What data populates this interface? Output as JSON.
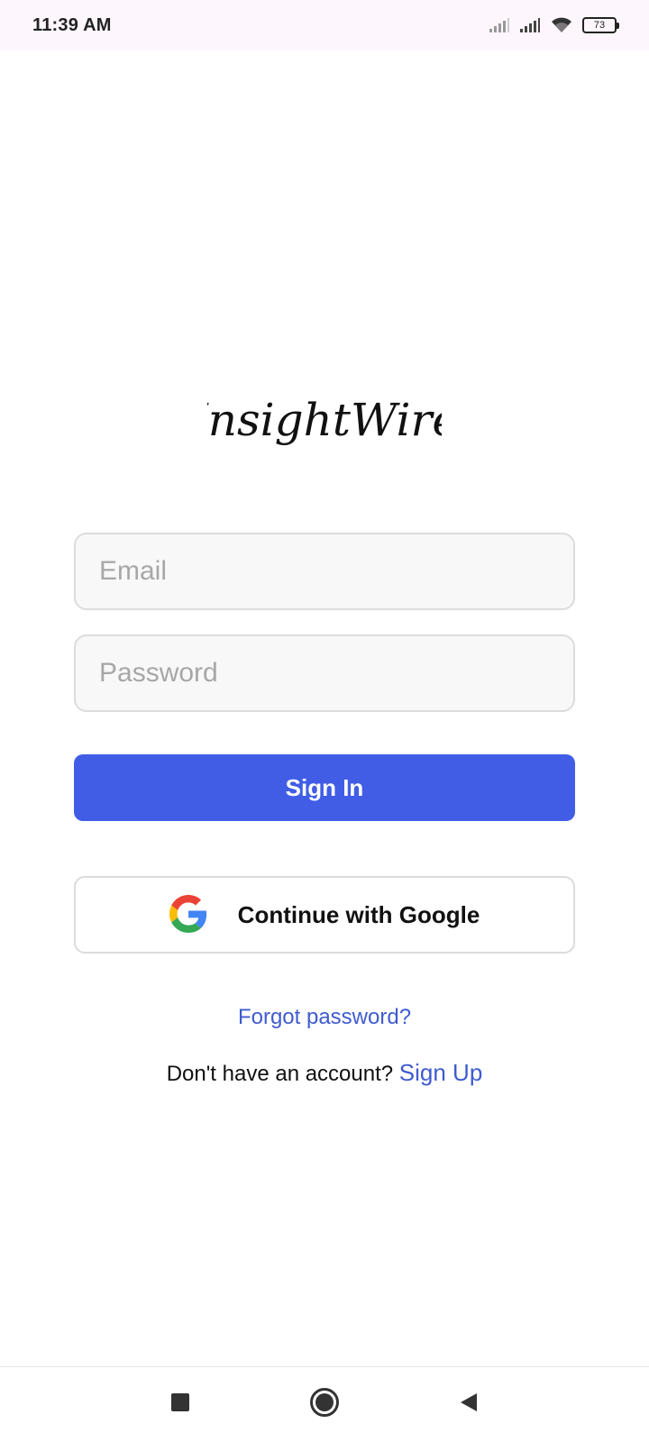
{
  "status_bar": {
    "time": "11:39 AM",
    "battery_level": "73",
    "icons": [
      "signal-icon",
      "signal-icon",
      "wifi-icon",
      "battery-icon"
    ]
  },
  "app": {
    "logo_text": "InsightWire"
  },
  "form": {
    "email_placeholder": "Email",
    "email_value": "",
    "password_placeholder": "Password",
    "password_value": "",
    "signin_label": "Sign In",
    "google_label": "Continue with Google",
    "forgot_label": "Forgot password?",
    "no_account_text": "Don't have an account?",
    "signup_label": "Sign Up"
  },
  "colors": {
    "primary": "#415de6",
    "link": "#3f5bd0",
    "field_bg": "#f8f8f8",
    "field_border": "#dcdcdc"
  },
  "nav": {
    "icons": [
      "recent-apps-icon",
      "home-icon",
      "back-icon"
    ]
  }
}
